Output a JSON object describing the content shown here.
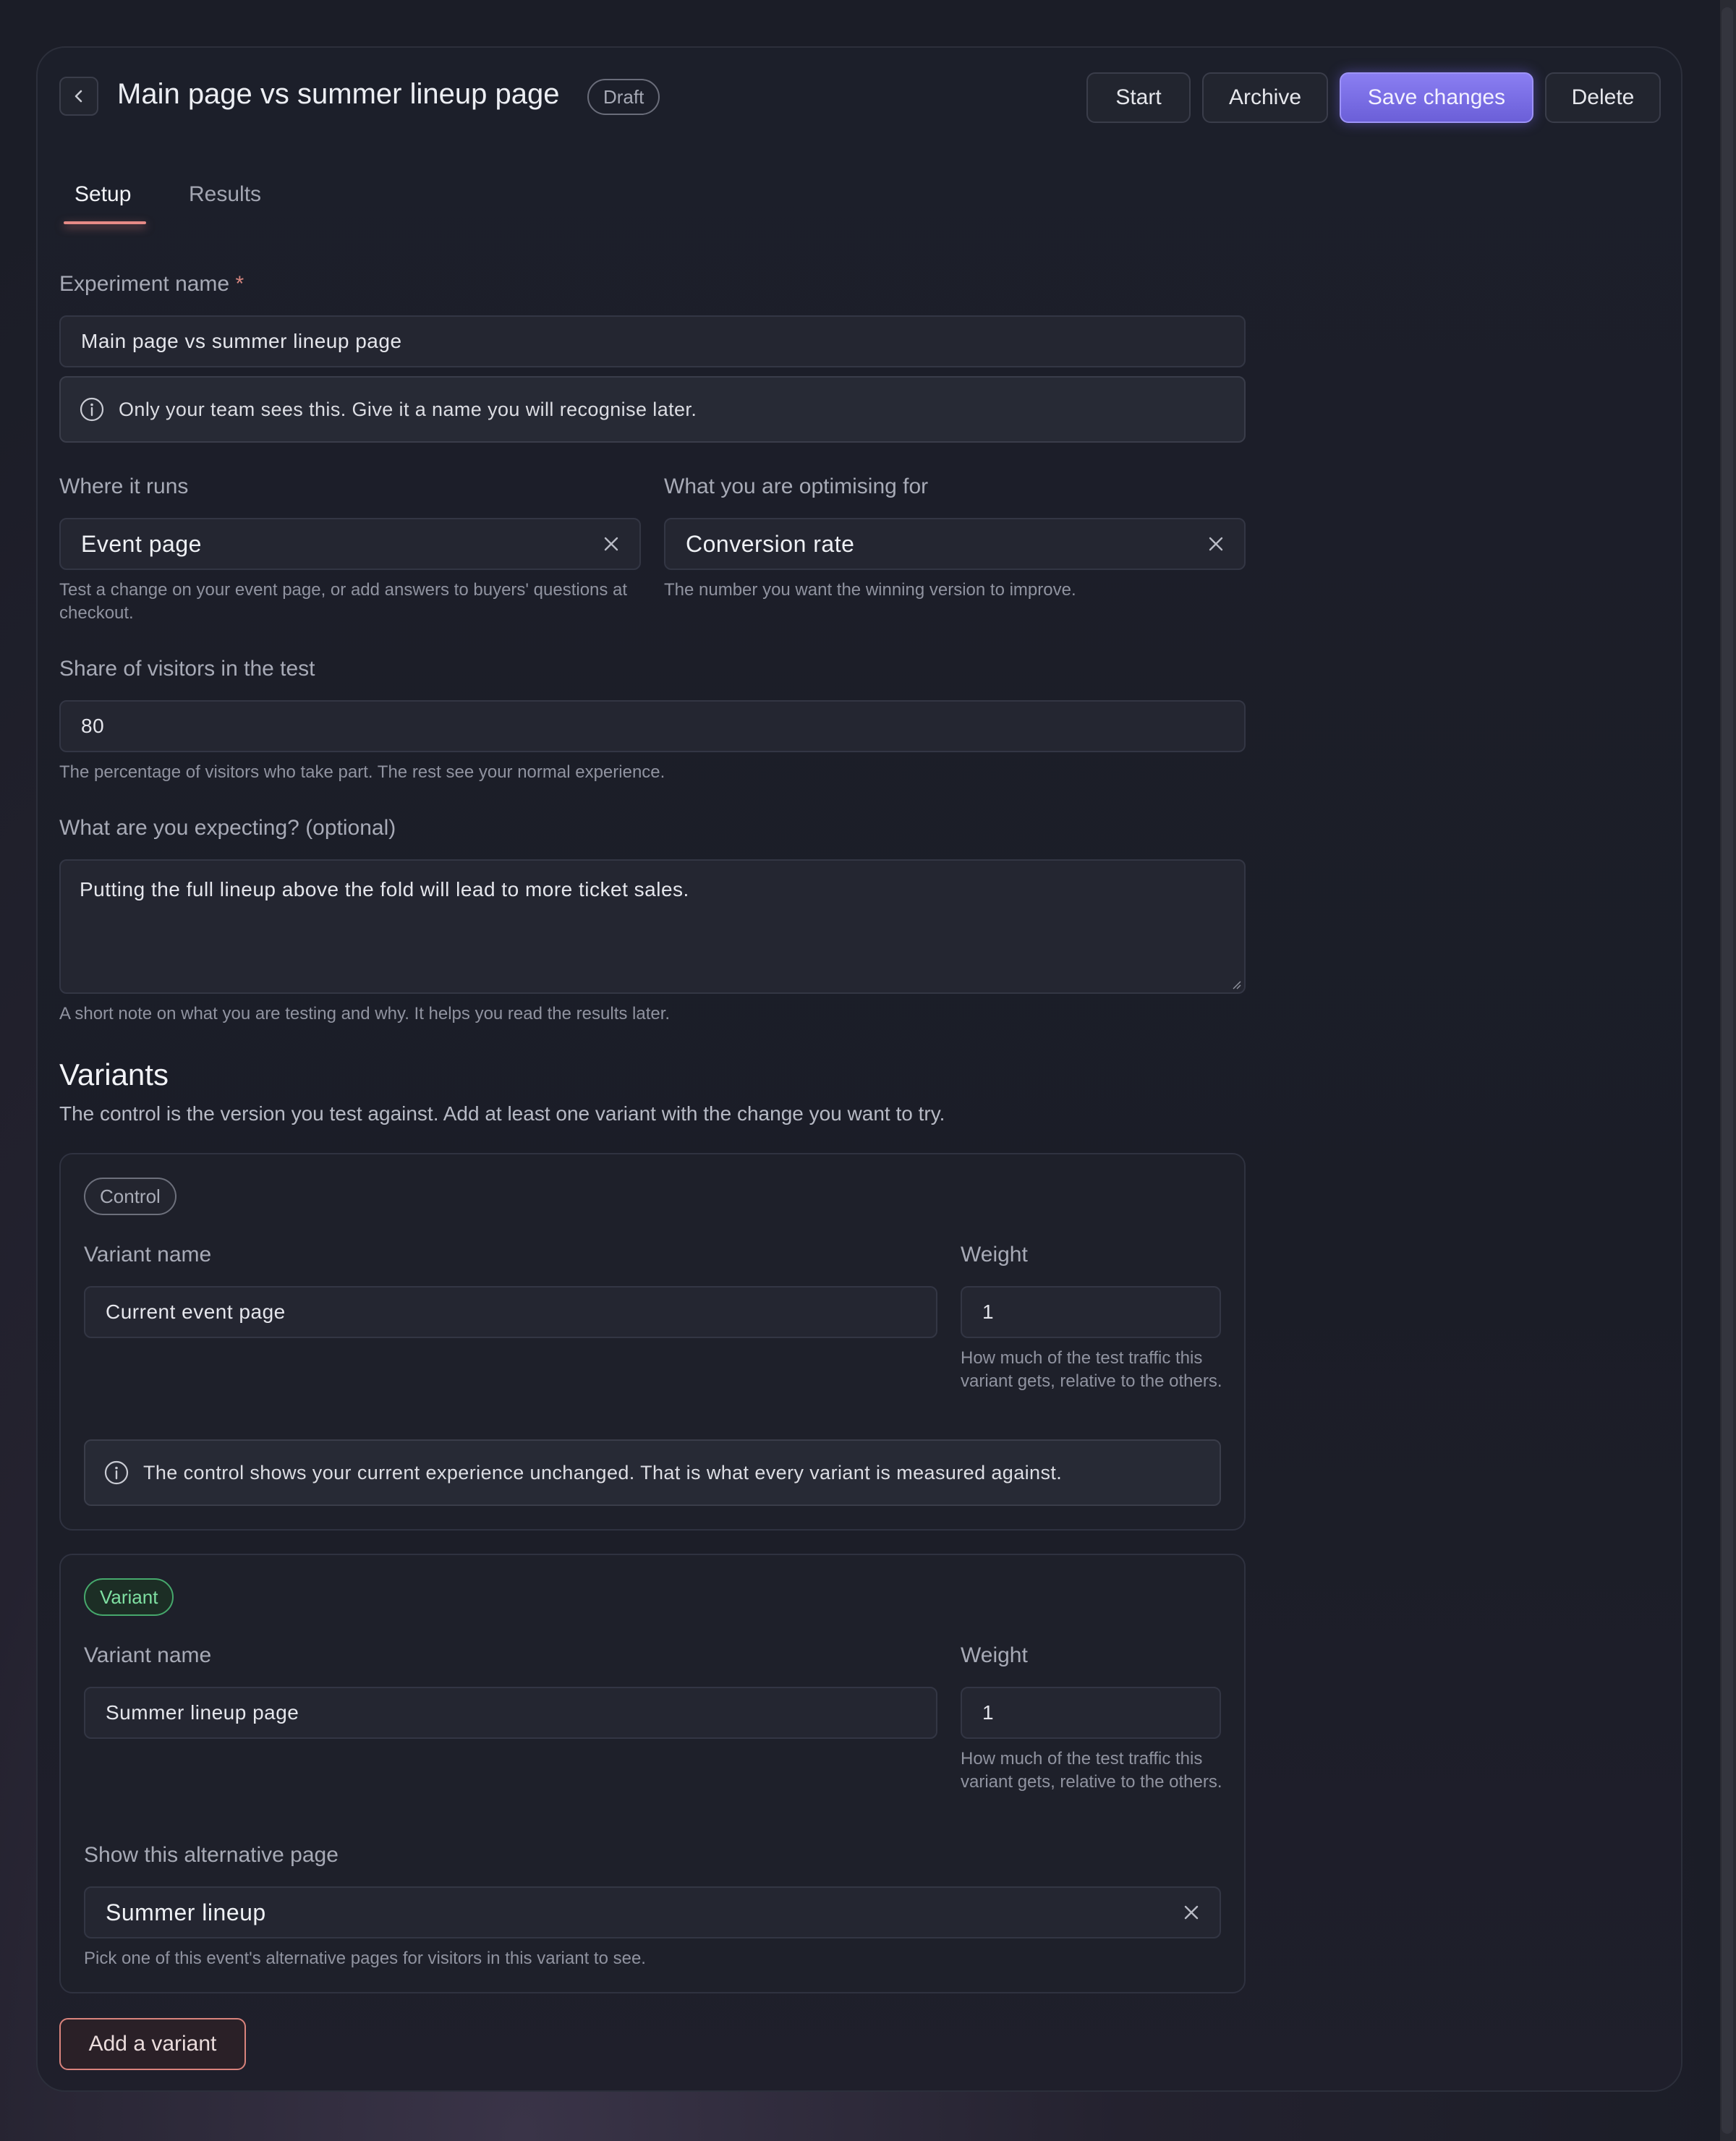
{
  "header": {
    "title": "Main page vs summer lineup page",
    "status_badge": "Draft",
    "actions": {
      "start": "Start",
      "archive": "Archive",
      "save": "Save changes",
      "delete": "Delete"
    }
  },
  "tabs": [
    {
      "label": "Setup",
      "active": true
    },
    {
      "label": "Results",
      "active": false
    }
  ],
  "form": {
    "experiment_name": {
      "label": "Experiment name",
      "required_mark": "*",
      "value": "Main page vs summer lineup page",
      "info": "Only your team sees this. Give it a name you will recognise later."
    },
    "where_it_runs": {
      "label": "Where it runs",
      "value": "Event page",
      "help": "Test a change on your event page, or add answers to buyers' questions at checkout."
    },
    "optimising_for": {
      "label": "What you are optimising for",
      "value": "Conversion rate",
      "help": "The number you want the winning version to improve."
    },
    "share": {
      "label": "Share of visitors in the test",
      "value": "80",
      "help": "The percentage of visitors who take part. The rest see your normal experience."
    },
    "expecting": {
      "label": "What are you expecting? (optional)",
      "value": "Putting the full lineup above the fold will lead to more ticket sales.",
      "help": "A short note on what you are testing and why. It helps you read the results later."
    }
  },
  "variants": {
    "title": "Variants",
    "subtitle": "The control is the version you test against. Add at least one variant with the change you want to try.",
    "control": {
      "badge": "Control",
      "name_label": "Variant name",
      "name_value": "Current event page",
      "weight_label": "Weight",
      "weight_value": "1",
      "weight_help": "How much of the test traffic this variant gets, relative to the others.",
      "info": "The control shows your current experience unchanged. That is what every variant is measured against."
    },
    "variant": {
      "badge": "Variant",
      "name_label": "Variant name",
      "name_value": "Summer lineup page",
      "weight_label": "Weight",
      "weight_value": "1",
      "weight_help": "How much of the test traffic this variant gets, relative to the others.",
      "alt_page_label": "Show this alternative page",
      "alt_page_value": "Summer lineup",
      "alt_page_help": "Pick one of this event's alternative pages for visitors in this variant to see."
    },
    "add_button": "Add a variant"
  },
  "colors": {
    "accent": "#7b6fe6",
    "tab_underline": "#e58a86",
    "variant_badge": "#7fe0a2",
    "add_button_border": "#d9837c"
  },
  "icons": [
    "chevron-left-icon",
    "info-icon",
    "close-icon"
  ]
}
